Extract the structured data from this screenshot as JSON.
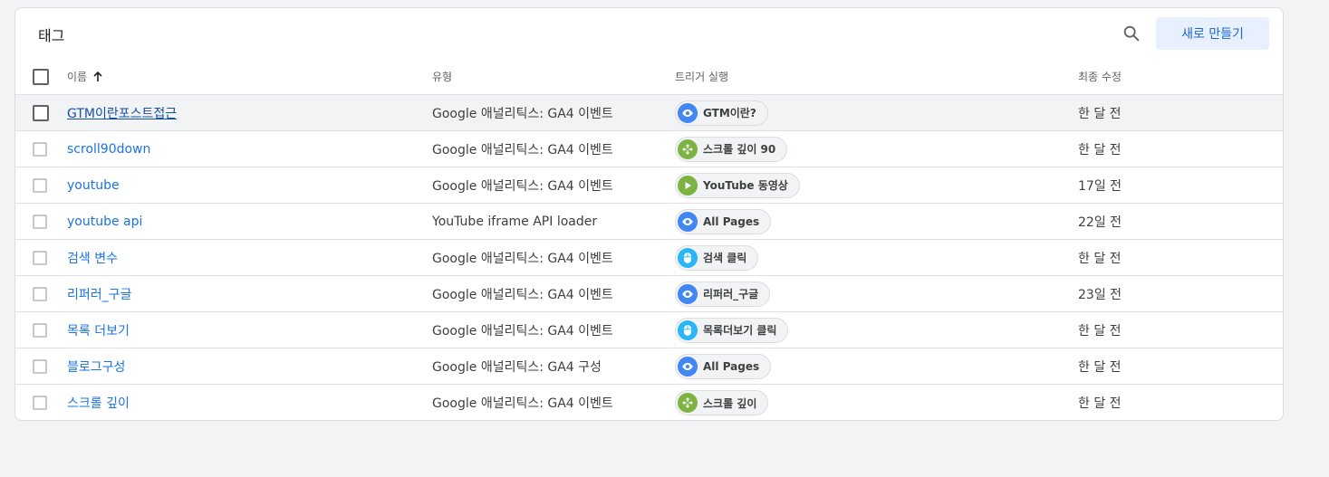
{
  "header": {
    "title": "태그",
    "new_button": "새로 만들기"
  },
  "columns": {
    "name": "이름",
    "type": "유형",
    "triggers": "트리거 실행",
    "modified": "최종 수정"
  },
  "colors": {
    "pageview": "#4285f4",
    "scroll": "#7cb342",
    "youtube": "#7cb342",
    "click": "#29b6f6",
    "link": "#1a73e8"
  },
  "rows": [
    {
      "name": "GTM이란포스트접근",
      "type": "Google 애널리틱스: GA4 이벤트",
      "trigger": "GTM이란?",
      "trigger_icon": "eye-icon",
      "modified": "한 달 전"
    },
    {
      "name": "scroll90down",
      "type": "Google 애널리틱스: GA4 이벤트",
      "trigger": "스크롤 깊이 90",
      "trigger_icon": "scroll-arrows-icon",
      "modified": "한 달 전"
    },
    {
      "name": "youtube",
      "type": "Google 애널리틱스: GA4 이벤트",
      "trigger": "YouTube 동영상",
      "trigger_icon": "play-icon",
      "modified": "17일 전"
    },
    {
      "name": "youtube api",
      "type": "YouTube iframe API loader",
      "trigger": "All Pages",
      "trigger_icon": "eye-icon",
      "modified": "22일 전"
    },
    {
      "name": "검색 변수",
      "type": "Google 애널리틱스: GA4 이벤트",
      "trigger": "검색 클릭",
      "trigger_icon": "mouse-icon",
      "modified": "한 달 전"
    },
    {
      "name": "리퍼러_구글",
      "type": "Google 애널리틱스: GA4 이벤트",
      "trigger": "리퍼러_구글",
      "trigger_icon": "eye-icon",
      "modified": "23일 전"
    },
    {
      "name": "목록 더보기",
      "type": "Google 애널리틱스: GA4 이벤트",
      "trigger": "목록더보기 클릭",
      "trigger_icon": "mouse-icon",
      "modified": "한 달 전"
    },
    {
      "name": "블로그구성",
      "type": "Google 애널리틱스: GA4 구성",
      "trigger": "All Pages",
      "trigger_icon": "eye-icon",
      "modified": "한 달 전"
    },
    {
      "name": "스크롤 깊이",
      "type": "Google 애널리틱스: GA4 이벤트",
      "trigger": "스크롤 깊이",
      "trigger_icon": "scroll-arrows-icon",
      "modified": "한 달 전"
    }
  ]
}
